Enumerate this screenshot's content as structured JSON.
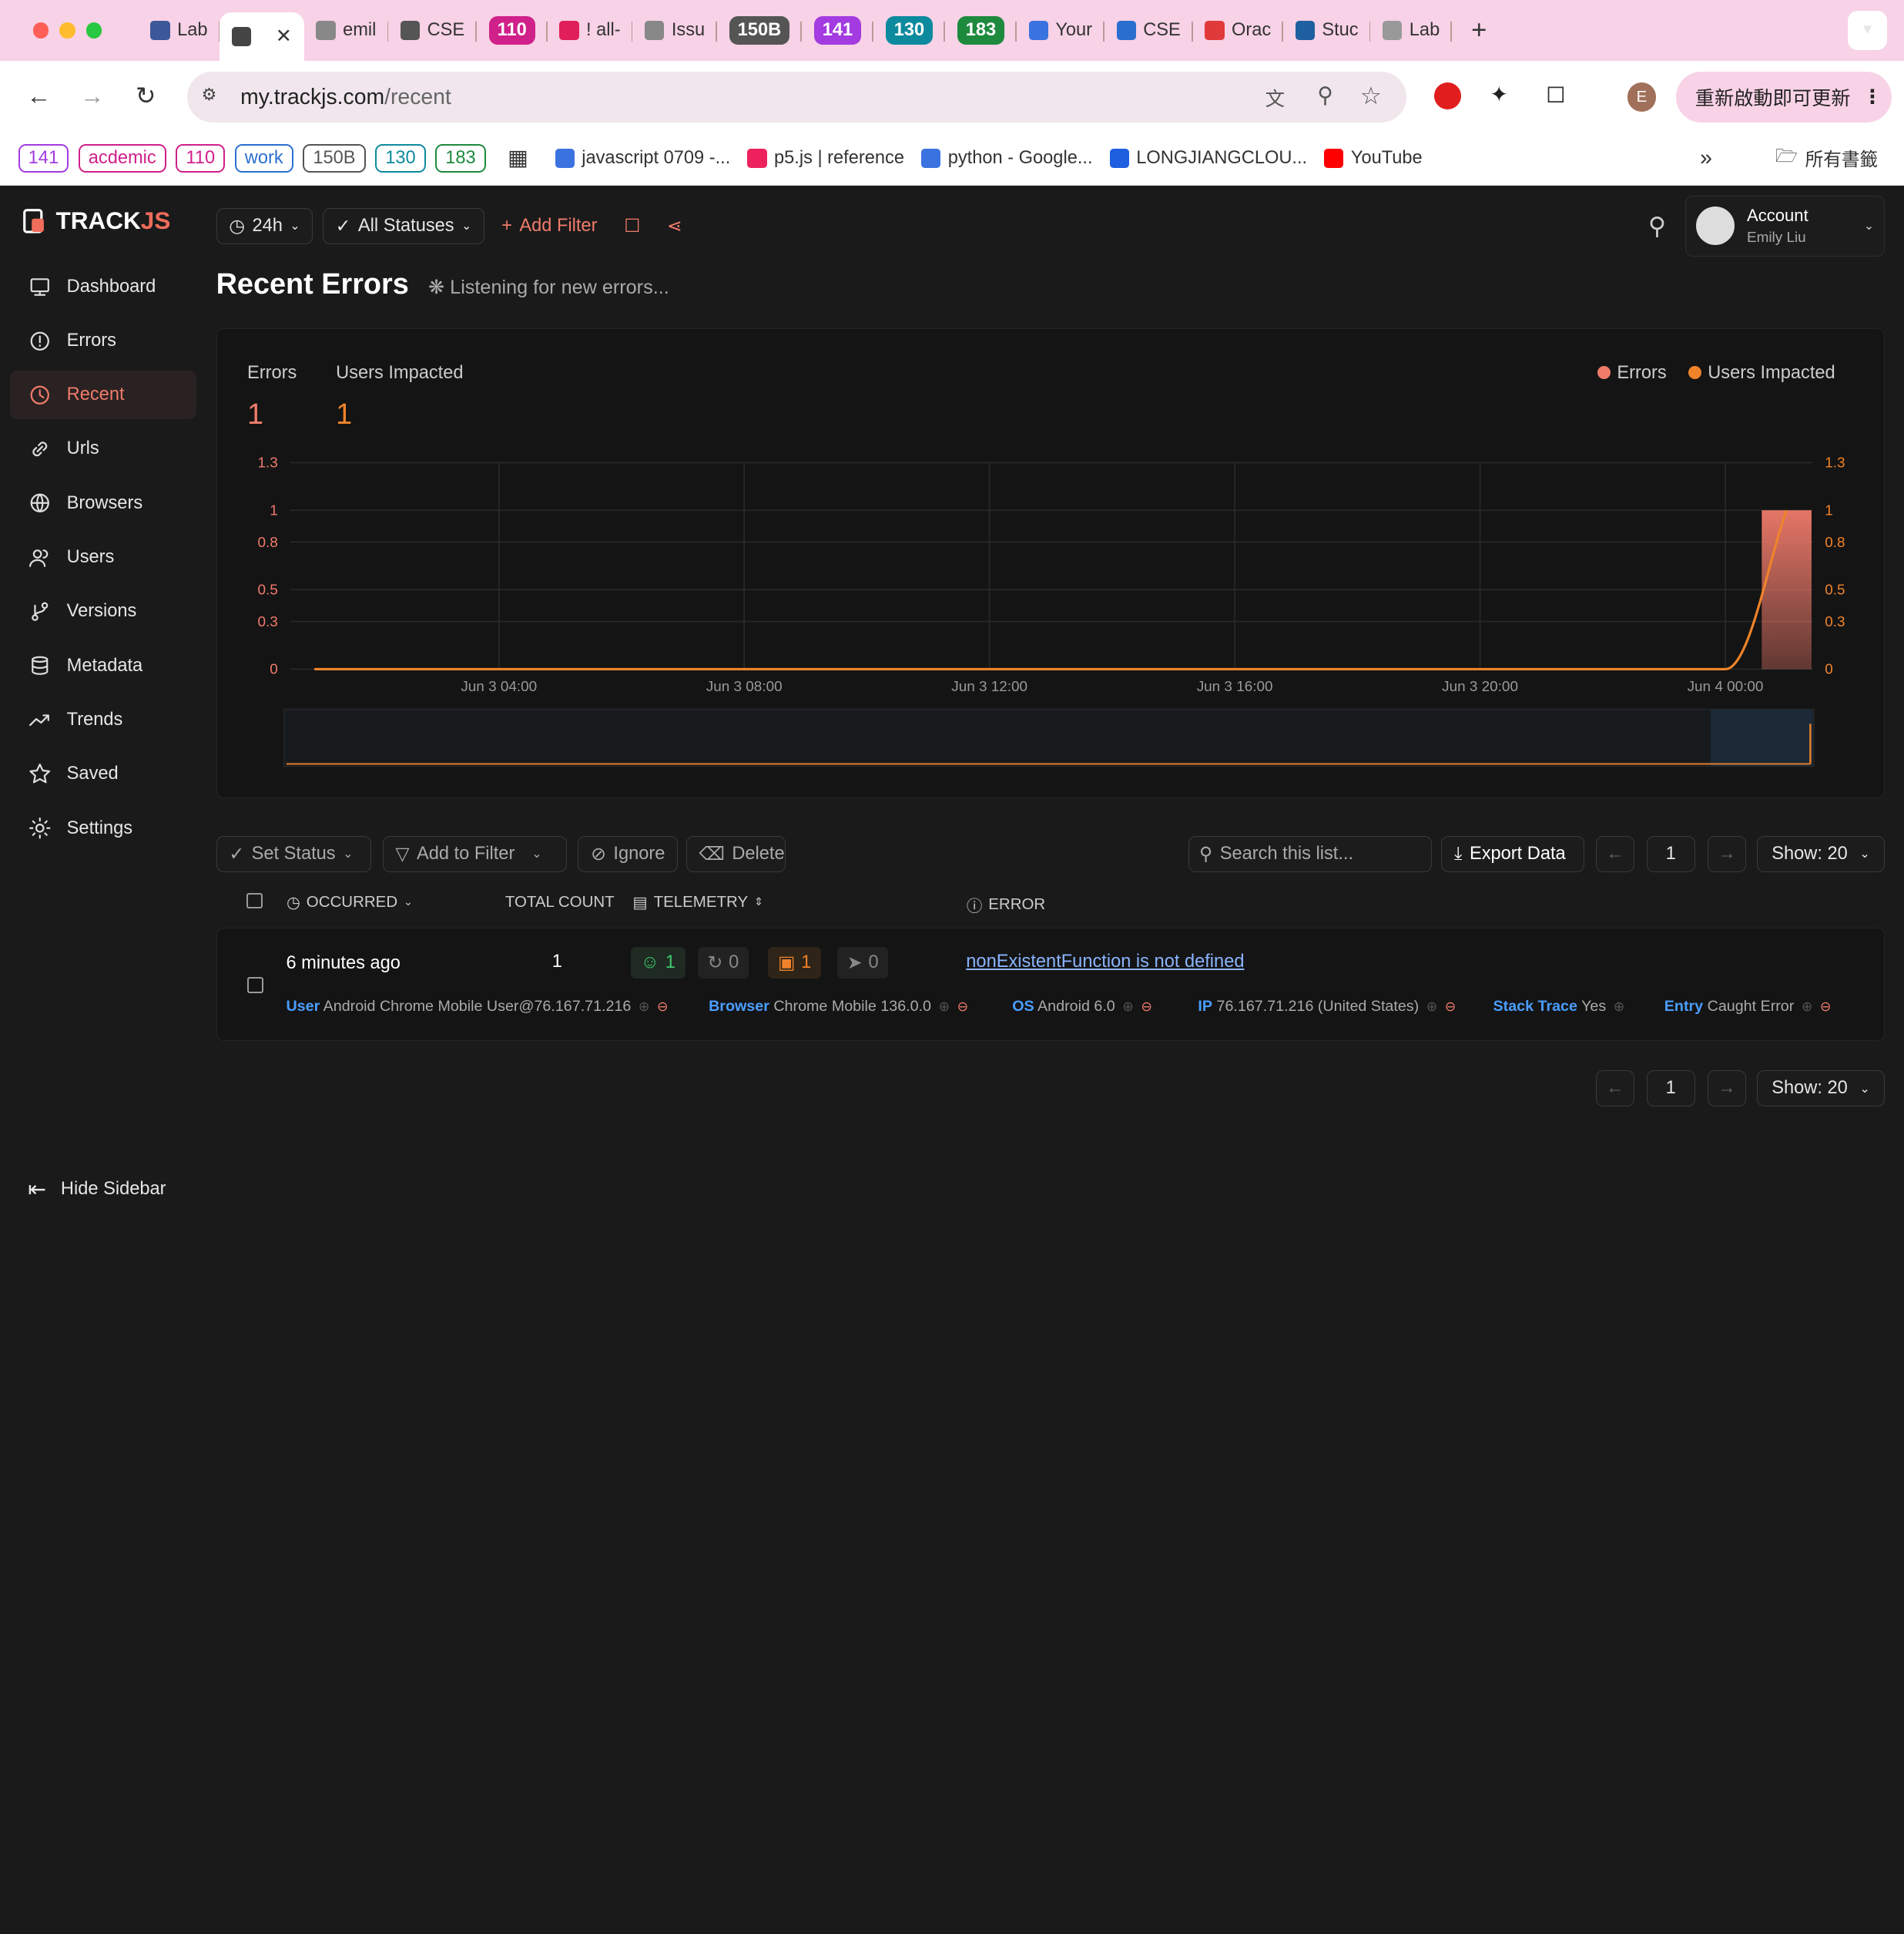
{
  "browser": {
    "tabs": [
      {
        "label": "Lab",
        "fav": "#3b5998"
      },
      {
        "label": "",
        "fav": "#444",
        "active": true
      },
      {
        "label": "emil",
        "fav": "#888"
      },
      {
        "label": "CSE",
        "fav": "#555"
      },
      {
        "label": "110",
        "pill": "#d0208a"
      },
      {
        "label": "! all-",
        "fav": "#e01e5a"
      },
      {
        "label": "Issu",
        "fav": "#888"
      },
      {
        "label": "150B",
        "pill": "#555"
      },
      {
        "label": "141",
        "pill": "#a33be0"
      },
      {
        "label": "130",
        "pill": "#0e8a9e"
      },
      {
        "label": "183",
        "pill": "#1e8a3e"
      },
      {
        "label": "Your",
        "fav": "#3a73e0"
      },
      {
        "label": "CSE",
        "fav": "#2a6fd0"
      },
      {
        "label": "Orac",
        "fav": "#e03a3a"
      },
      {
        "label": "Stuc",
        "fav": "#1e5fa0"
      },
      {
        "label": "Lab",
        "fav": "#999"
      }
    ],
    "url_host": "my.trackjs.com",
    "url_path": "/recent",
    "profile_initial": "E",
    "update_label": "重新啟動即可更新",
    "bookmarks_pills": [
      {
        "label": "141",
        "color": "#a33be0"
      },
      {
        "label": "acdemic",
        "color": "#d0208a"
      },
      {
        "label": "110",
        "color": "#d0208a"
      },
      {
        "label": "work",
        "color": "#2a6fd0"
      },
      {
        "label": "150B",
        "color": "#555"
      },
      {
        "label": "130",
        "color": "#0e8a9e"
      },
      {
        "label": "183",
        "color": "#1e8a3e"
      }
    ],
    "bookmarks": [
      {
        "label": "javascript 0709 -...",
        "fav": "#3a73e0"
      },
      {
        "label": "p5.js | reference",
        "fav": "#ed225d"
      },
      {
        "label": "python - Google...",
        "fav": "#3a73e0"
      },
      {
        "label": "LONGJIANGCLOU...",
        "fav": "#1e5fe0"
      },
      {
        "label": "YouTube",
        "fav": "#ff0000"
      }
    ],
    "all_bookmarks": "所有書籤"
  },
  "app": {
    "logo_a": "TRACK",
    "logo_b": "JS",
    "nav": [
      {
        "label": "Dashboard",
        "icon": "dashboard-icon"
      },
      {
        "label": "Errors",
        "icon": "errors-icon"
      },
      {
        "label": "Recent",
        "icon": "clock-icon",
        "active": true
      },
      {
        "label": "Urls",
        "icon": "link-icon"
      },
      {
        "label": "Browsers",
        "icon": "globe-icon"
      },
      {
        "label": "Users",
        "icon": "users-icon"
      },
      {
        "label": "Versions",
        "icon": "branch-icon"
      },
      {
        "label": "Metadata",
        "icon": "database-icon"
      },
      {
        "label": "Trends",
        "icon": "trends-icon"
      },
      {
        "label": "Saved",
        "icon": "star-icon"
      },
      {
        "label": "Settings",
        "icon": "gear-icon"
      }
    ],
    "hide_sidebar": "Hide Sidebar",
    "range": "24h",
    "status": "All Statuses",
    "add_filter": "Add Filter",
    "account_label": "Account",
    "account_name": "Emily Liu",
    "page_title": "Recent Errors",
    "listening": "Listening for new errors...",
    "stats": {
      "errors_label": "Errors",
      "errors_value": "1",
      "users_label": "Users Impacted",
      "users_value": "1"
    },
    "legend": [
      {
        "label": "Errors",
        "color": "#f07b6b"
      },
      {
        "label": "Users Impacted",
        "color": "#f0832a"
      }
    ],
    "actions": {
      "set_status": "Set Status",
      "add_to_filter": "Add to Filter",
      "ignore": "Ignore",
      "delete": "Delete",
      "search_placeholder": "Search this list...",
      "export": "Export Data",
      "page": "1",
      "show": "Show: 20"
    },
    "columns": {
      "occurred": "OCCURRED",
      "total_count": "TOTAL COUNT",
      "telemetry": "TELEMETRY",
      "error": "ERROR"
    },
    "row": {
      "occurred": "6 minutes ago",
      "count": "1",
      "telemetry": [
        "1",
        "0",
        "1",
        "0"
      ],
      "error": "nonExistentFunction is not defined",
      "meta": [
        {
          "k": "User",
          "v": "Android Chrome Mobile User@76.167.71.216"
        },
        {
          "k": "Browser",
          "v": "Chrome Mobile 136.0.0"
        },
        {
          "k": "OS",
          "v": "Android 6.0"
        },
        {
          "k": "IP",
          "v": "76.167.71.216 (United States)"
        },
        {
          "k": "Stack Trace",
          "v": "Yes"
        },
        {
          "k": "Entry",
          "v": "Caught Error"
        }
      ]
    }
  },
  "chart_data": {
    "type": "line",
    "x_ticks": [
      "Jun 3 04:00",
      "Jun 3 08:00",
      "Jun 3 12:00",
      "Jun 3 16:00",
      "Jun 3 20:00",
      "Jun 4 00:00"
    ],
    "y_ticks": [
      "0",
      "0.3",
      "0.5",
      "0.8",
      "1",
      "1.3"
    ],
    "ylim": [
      0,
      1.3
    ],
    "series": [
      {
        "name": "Errors",
        "type": "bar",
        "color": "#f07b6b",
        "points": [
          {
            "x": "Jun 4 01:00",
            "y": 1
          }
        ]
      },
      {
        "name": "Users Impacted",
        "type": "line",
        "color": "#f0832a",
        "points": [
          {
            "x": "Jun 3 01:00",
            "y": 0
          },
          {
            "x": "Jun 4 00:00",
            "y": 0
          },
          {
            "x": "Jun 4 01:00",
            "y": 1
          }
        ]
      }
    ]
  }
}
